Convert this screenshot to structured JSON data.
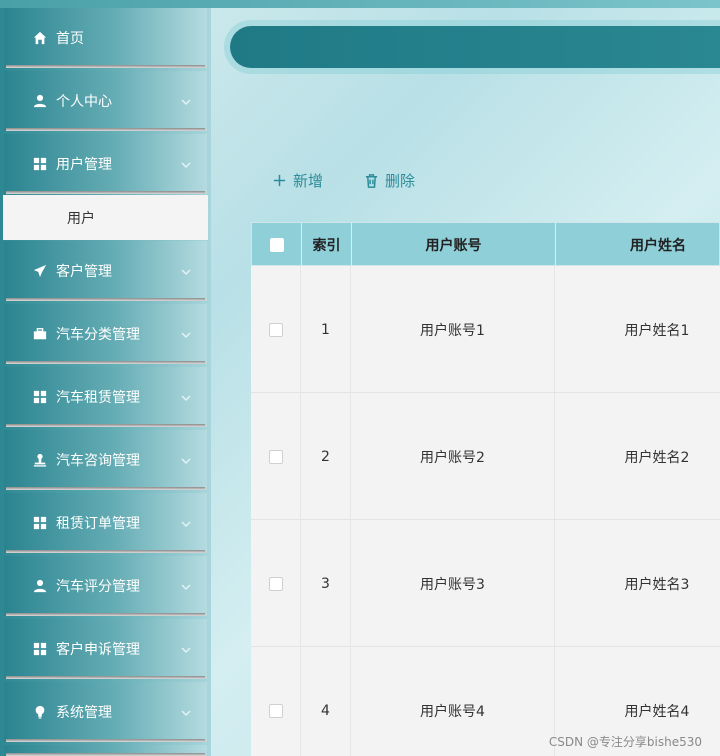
{
  "sidebar": {
    "items": [
      {
        "label": "首页",
        "icon": "home-icon",
        "expandable": false
      },
      {
        "label": "个人中心",
        "icon": "user-icon",
        "expandable": true
      },
      {
        "label": "用户管理",
        "icon": "grid-icon",
        "expandable": true
      },
      {
        "label": "客户管理",
        "icon": "send-icon",
        "expandable": true
      },
      {
        "label": "汽车分类管理",
        "icon": "briefcase-icon",
        "expandable": true
      },
      {
        "label": "汽车租赁管理",
        "icon": "grid-icon",
        "expandable": true
      },
      {
        "label": "汽车咨询管理",
        "icon": "stamp-icon",
        "expandable": true
      },
      {
        "label": "租赁订单管理",
        "icon": "grid-icon",
        "expandable": true
      },
      {
        "label": "汽车评分管理",
        "icon": "user-icon",
        "expandable": true
      },
      {
        "label": "客户申诉管理",
        "icon": "grid-icon",
        "expandable": true
      },
      {
        "label": "系统管理",
        "icon": "bulb-icon",
        "expandable": true
      }
    ],
    "submenu": {
      "label": "用户"
    }
  },
  "toolbar": {
    "add_label": "新增",
    "delete_label": "删除"
  },
  "table": {
    "columns": [
      "",
      "索引",
      "用户账号",
      "用户姓名"
    ],
    "rows": [
      {
        "index": "1",
        "account": "用户账号1",
        "name": "用户姓名1"
      },
      {
        "index": "2",
        "account": "用户账号2",
        "name": "用户姓名2"
      },
      {
        "index": "3",
        "account": "用户账号3",
        "name": "用户姓名3"
      },
      {
        "index": "4",
        "account": "用户账号4",
        "name": "用户姓名4"
      }
    ]
  },
  "watermark": "CSDN @专注分享bishe530",
  "colors": {
    "accent": "#2c8c99",
    "header": "#1f7a86",
    "table_header": "#8ecfd8"
  }
}
